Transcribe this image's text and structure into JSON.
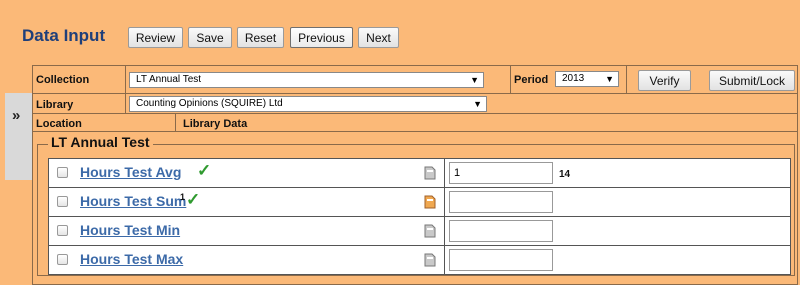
{
  "header": {
    "title": "Data Input",
    "buttons": [
      "Review",
      "Save",
      "Reset",
      "Previous",
      "Next"
    ]
  },
  "form": {
    "collection_label": "Collection",
    "collection_value": "LT Annual Test",
    "period_label": "Period",
    "period_value": "2013",
    "verify_label": "Verify",
    "submit_label": "Submit/Lock",
    "library_label": "Library",
    "library_value": "Counting Opinions (SQUIRE) Ltd",
    "location_label": "Location",
    "library_data_label": "Library Data",
    "expand_glyph": "»"
  },
  "section": {
    "legend": "LT Annual Test",
    "rows": [
      {
        "label": "Hours Test Avg",
        "sup": "",
        "checked_icon": "✓",
        "value": "1",
        "extra": "14",
        "note_color": "#c9c9c9"
      },
      {
        "label": "Hours Test Sum",
        "sup": "1",
        "checked_icon": "✓",
        "value": "",
        "extra": "",
        "note_color": "#f0a850"
      },
      {
        "label": "Hours Test Min",
        "sup": "",
        "checked_icon": "",
        "value": "",
        "extra": "",
        "note_color": "#c9c9c9"
      },
      {
        "label": "Hours Test Max",
        "sup": "",
        "checked_icon": "",
        "value": "",
        "extra": "",
        "note_color": "#c9c9c9"
      }
    ]
  },
  "colors": {
    "background": "#fbb978",
    "title": "#1f3f7a",
    "link": "#3c6aa8",
    "check": "#2f9a2f"
  }
}
